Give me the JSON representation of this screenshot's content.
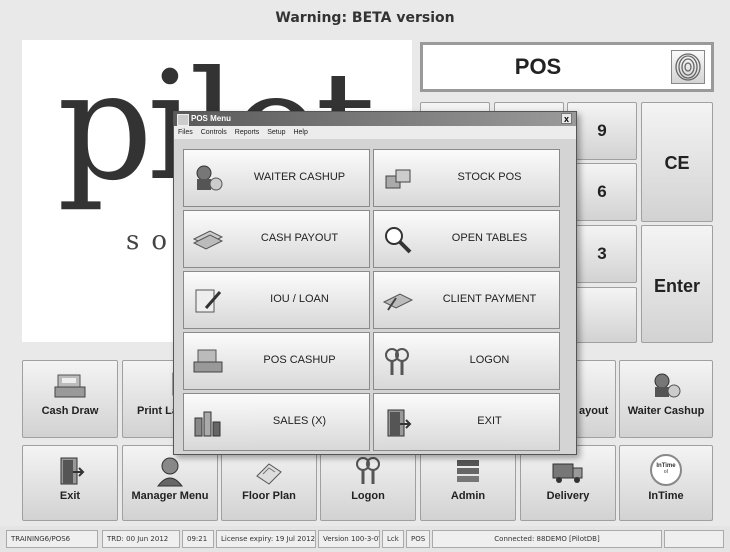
{
  "banner": "Warning: BETA version",
  "logo": {
    "text": "pilot",
    "small": "so"
  },
  "pos_panel": {
    "title": "POS"
  },
  "keypad": {
    "k9": "9",
    "k6": "6",
    "k3": "3",
    "ce": "CE",
    "enter": "Enter"
  },
  "bottom_row1": [
    "Cash Draw",
    "Print La",
    "ayout",
    "Waiter Cashup"
  ],
  "bottom_row2": [
    "Exit",
    "Manager Menu",
    "Floor Plan",
    "Logon",
    "Admin",
    "Delivery",
    "InTime"
  ],
  "intime_logo": {
    "line1": "InTime",
    "line2": "ol"
  },
  "modal": {
    "title": "POS Menu",
    "close": "x",
    "menus": [
      "Files",
      "Controls",
      "Reports",
      "Setup",
      "Help"
    ],
    "buttons": {
      "waiter_cashup": "WAITER CASHUP",
      "stock_pos": "STOCK POS",
      "cash_payout": "CASH PAYOUT",
      "open_tables": "OPEN TABLES",
      "iou_loan": "IOU / LOAN",
      "client_payment": "CLIENT PAYMENT",
      "pos_cashup": "POS CASHUP",
      "logon": "LOGON",
      "sales_x": "SALES (X)",
      "exit": "EXIT"
    }
  },
  "status": {
    "terminal": "TRAINING6/POS6",
    "trd": "TRD: 00 Jun 2012",
    "time": "09:21",
    "license": "License expiry: 19 Jul 2012",
    "version": "Version 100-3-0Y",
    "lck": "Lck",
    "pos": "POS",
    "connected": "Connected: 88DEMO [PilotDB]"
  },
  "colors": {
    "background": "#e9e9e9",
    "button_top": "#f4f4f4",
    "button_bottom": "#d2d2d2"
  }
}
